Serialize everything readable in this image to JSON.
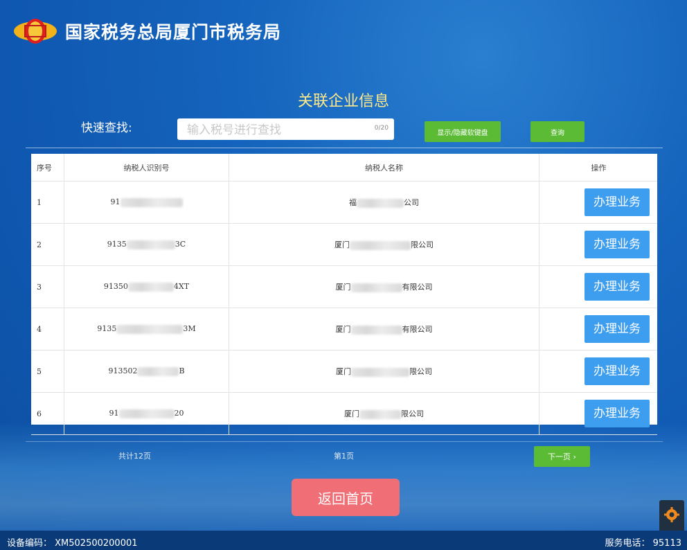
{
  "header": {
    "title": "国家税务总局厦门市税务局",
    "logo_text": "税"
  },
  "page_heading": "关联企业信息",
  "search": {
    "label": "快速查找:",
    "placeholder": "输入税号进行查找",
    "value": "",
    "counter": "0/20",
    "keyboard_button": "显示/隐藏软键盘",
    "query_button": "查询"
  },
  "table": {
    "headers": [
      "序号",
      "纳税人识别号",
      "纳税人名称",
      "操作"
    ],
    "rows": [
      {
        "index": "1",
        "id_prefix": "91",
        "id_suffix": "",
        "name_prefix": "福",
        "name_suffix": "公司",
        "action": "办理业务"
      },
      {
        "index": "2",
        "id_prefix": "9135",
        "id_suffix": "3C",
        "name_prefix": "厦门",
        "name_suffix": "限公司",
        "action": "办理业务"
      },
      {
        "index": "3",
        "id_prefix": "91350",
        "id_suffix": "4XT",
        "name_prefix": "厦门",
        "name_suffix": "有限公司",
        "action": "办理业务"
      },
      {
        "index": "4",
        "id_prefix": "9135",
        "id_suffix": "3M",
        "name_prefix": "厦门",
        "name_suffix": "有限公司",
        "action": "办理业务"
      },
      {
        "index": "5",
        "id_prefix": "913502",
        "id_suffix": "B",
        "name_prefix": "厦门",
        "name_suffix": "限公司",
        "action": "办理业务"
      },
      {
        "index": "6",
        "id_prefix": "91",
        "id_suffix": "20",
        "name_prefix": "厦门",
        "name_suffix": "限公司",
        "action": "办理业务"
      }
    ]
  },
  "pager": {
    "total": "共计12页",
    "current": "第1页",
    "next": "下一页 ›"
  },
  "home_button": "返回首页",
  "footer": {
    "device_code": "设备编码： XM502500200001",
    "service_phone": "服务电话： 95113"
  },
  "colors": {
    "accent_green": "#5bbb35",
    "action_blue": "#3d9ef0",
    "home_red": "#f06e75",
    "heading_yellow": "#ffe98a"
  }
}
